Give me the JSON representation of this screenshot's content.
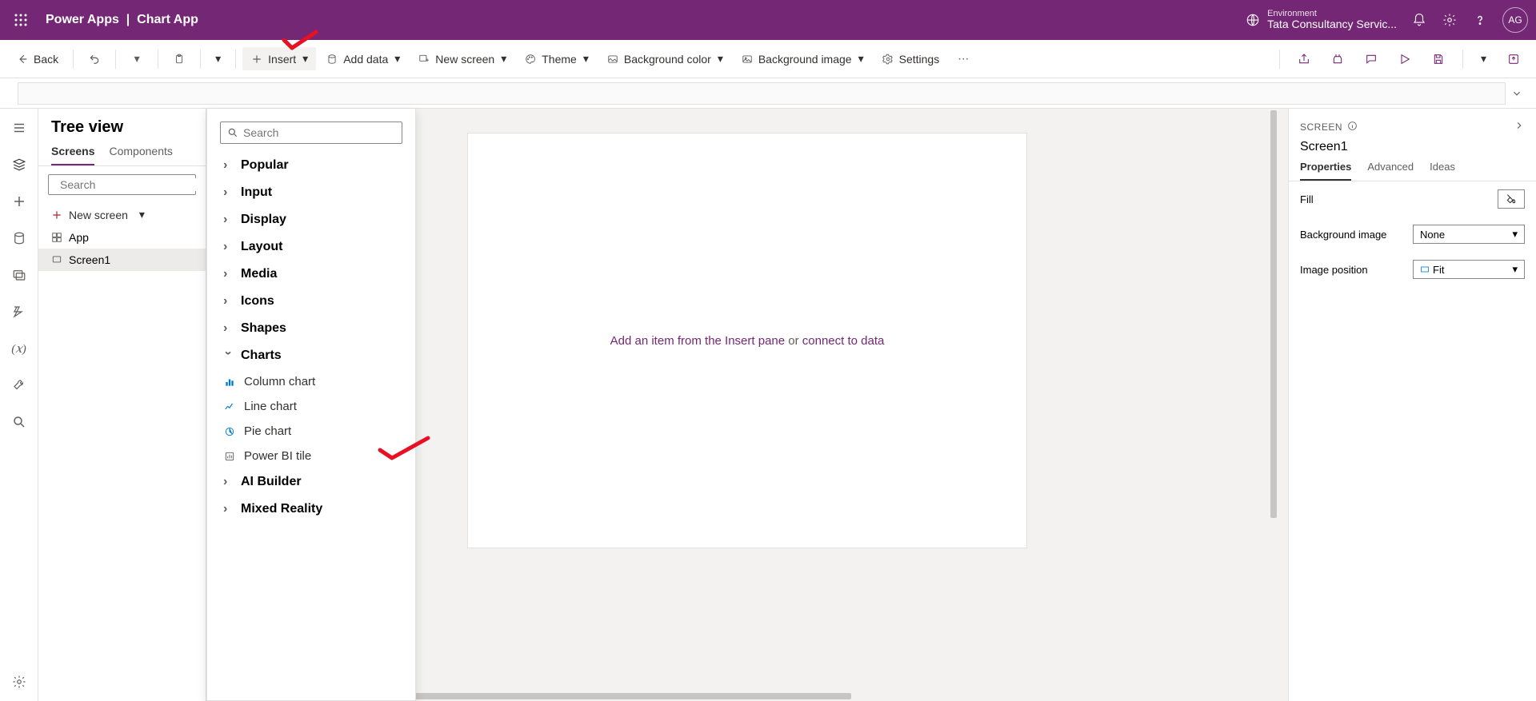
{
  "header": {
    "product": "Power Apps",
    "app_name": "Chart App",
    "env_label": "Environment",
    "env_name": "Tata Consultancy Servic...",
    "avatar": "AG"
  },
  "toolbar": {
    "back": "Back",
    "insert": "Insert",
    "add_data": "Add data",
    "new_screen": "New screen",
    "theme": "Theme",
    "background_color": "Background color",
    "background_image": "Background image",
    "settings": "Settings"
  },
  "tree": {
    "title": "Tree view",
    "tabs": {
      "screens": "Screens",
      "components": "Components"
    },
    "search_placeholder": "Search",
    "new_screen": "New screen",
    "items": {
      "app": "App",
      "screen1": "Screen1"
    }
  },
  "insert_panel": {
    "search_placeholder": "Search",
    "categories": {
      "popular": "Popular",
      "input": "Input",
      "display": "Display",
      "layout": "Layout",
      "media": "Media",
      "icons": "Icons",
      "shapes": "Shapes",
      "charts": "Charts",
      "ai_builder": "AI Builder",
      "mixed_reality": "Mixed Reality"
    },
    "chart_items": {
      "column": "Column chart",
      "line": "Line chart",
      "pie": "Pie chart",
      "powerbi": "Power BI tile"
    }
  },
  "canvas": {
    "hint_prefix": "Add an item from the Insert pane",
    "hint_or": " or ",
    "hint_link": "connect to data"
  },
  "props": {
    "head": "SCREEN",
    "screen": "Screen1",
    "tabs": {
      "properties": "Properties",
      "advanced": "Advanced",
      "ideas": "Ideas"
    },
    "rows": {
      "fill": "Fill",
      "bg_image": "Background image",
      "bg_image_value": "None",
      "image_position": "Image position",
      "image_position_value": "Fit"
    }
  }
}
